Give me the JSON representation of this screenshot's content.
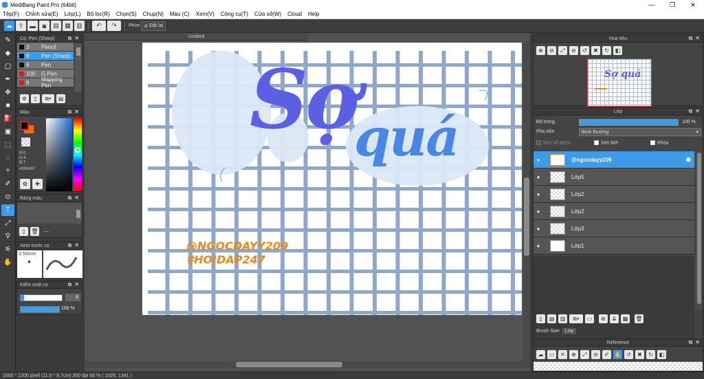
{
  "window": {
    "title": "MediBang Paint Pro (64bit)",
    "min": "—",
    "max": "❐",
    "close": "✕"
  },
  "menu": [
    "Tệp(F)",
    "Chỉnh sửa(E)",
    "Lớp(L)",
    "Bộ lọc(R)",
    "Chọn(S)",
    "Chụp(N)",
    "Màu (C)",
    "Xem(V)",
    "Công cụ(T)",
    "Cửa sổ(W)",
    "Cloud",
    "Help"
  ],
  "toolbar": {
    "shortcut_label": "Phím",
    "reset_label": "Đặt lại"
  },
  "brush_panel": {
    "title": "Cọ: Pen (Sharp)",
    "items": [
      {
        "size": "3",
        "name": "Pencil",
        "color": "#111111"
      },
      {
        "size": "8",
        "name": "Pen (Sharp)",
        "color": "#111111"
      },
      {
        "size": "8",
        "name": "Pen",
        "color": "#111111"
      },
      {
        "size": "100",
        "name": "G Pen",
        "color": "#d02020"
      },
      {
        "size": "8",
        "name": "Mapping Pen",
        "color": "#d02020"
      }
    ]
  },
  "color_panel": {
    "title": "Màu",
    "r": "R:0",
    "g": "G:4",
    "b": "B:7",
    "hex": "#000407",
    "fg": "#000407",
    "bg": "#e8700a"
  },
  "palette_panel": {
    "title": "Bảng màu",
    "more": "---"
  },
  "preview_panel": {
    "title": "Xem trước cọ",
    "size_label": "0.58mm"
  },
  "control_panel": {
    "title": "Kiểm soát cọ",
    "size_value": "8",
    "opacity_value": "100 %"
  },
  "document": {
    "tab_title": "Untitled",
    "headline_1": "Sợ",
    "headline_2": "quá",
    "watermark_1": "@NGOCDAYY209",
    "watermark_2": "#HOIDAP247"
  },
  "navigator": {
    "title": "Hoa tiêu",
    "thumb_text": "Sợ quá"
  },
  "layer_panel": {
    "title": "Lớp",
    "opacity_label": "Độ trong",
    "opacity_value": "100 %",
    "opacity_fraction": 1.0,
    "blend_label": "Pha trộn",
    "blend_value": "Bình thường",
    "protect_alpha": "Bảo vệ alpha",
    "clipping": "Xén bớt",
    "lock": "Khóa",
    "layers": [
      {
        "name": "@ngocdayy209",
        "selected": true
      },
      {
        "name": "Lớp5",
        "selected": false
      },
      {
        "name": "Lớp2",
        "selected": false
      },
      {
        "name": "Lớp2",
        "selected": false
      },
      {
        "name": "Lớp3",
        "selected": false
      },
      {
        "name": "Lớp1",
        "selected": false
      }
    ]
  },
  "bottom_tabs": {
    "tab1": "Brush Size",
    "tab2": "Lớp"
  },
  "reference_panel": {
    "title": "Reference"
  },
  "status": {
    "text": "1600 * 1200 pixel  (11.6 * 8.7cm)  350 dpi  66 %  ( 1026, 1341 )"
  },
  "colors": {
    "accent": "#3e9be9",
    "grid": "#8fa8c9",
    "text_orange": "#e88a20"
  }
}
